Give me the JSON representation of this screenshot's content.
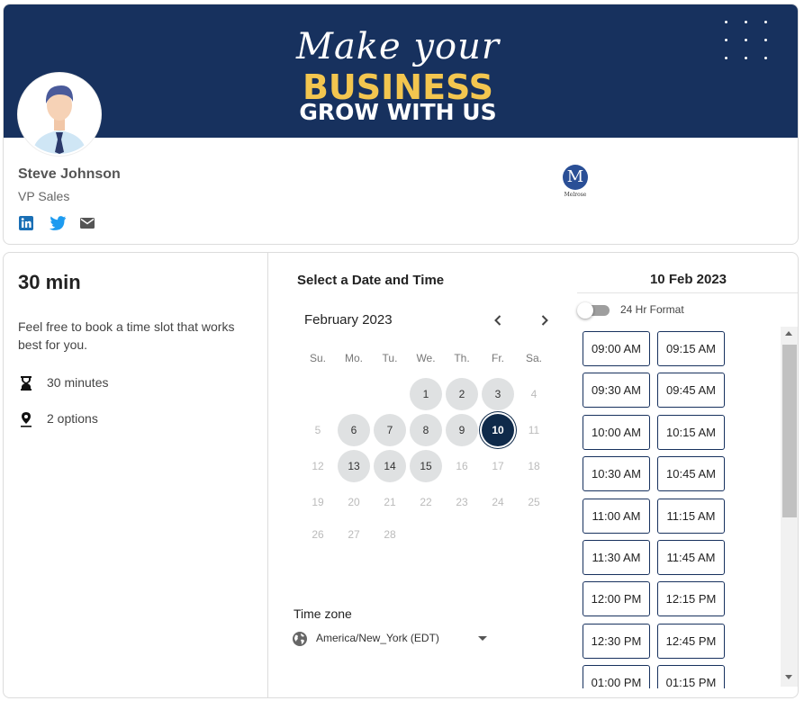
{
  "banner": {
    "line1": "Make your",
    "line2": "BUSINESS",
    "line3": "GROW WITH US",
    "bg_color": "#17315e",
    "accent_color": "#f3c64f"
  },
  "profile": {
    "name": "Steve Johnson",
    "title": "VP Sales",
    "socials": [
      "linkedin-icon",
      "twitter-icon",
      "email-icon"
    ],
    "company_logo": {
      "letter": "M",
      "text": "Melrose"
    }
  },
  "event": {
    "duration_title": "30 min",
    "description": "Feel free to book a time slot that works best for you.",
    "duration_text": "30 minutes",
    "location_text": "2 options"
  },
  "calendar": {
    "heading": "Select a Date and Time",
    "month": "February 2023",
    "weekdays": [
      "Su.",
      "Mo.",
      "Tu.",
      "We.",
      "Th.",
      "Fr.",
      "Sa."
    ],
    "days": [
      {
        "d": "1",
        "s": "avail"
      },
      {
        "d": "2",
        "s": "avail"
      },
      {
        "d": "3",
        "s": "avail"
      },
      {
        "d": "4",
        "s": "off"
      },
      {
        "d": "5",
        "s": "off"
      },
      {
        "d": "6",
        "s": "avail"
      },
      {
        "d": "7",
        "s": "avail"
      },
      {
        "d": "8",
        "s": "avail"
      },
      {
        "d": "9",
        "s": "avail"
      },
      {
        "d": "10",
        "s": "selected"
      },
      {
        "d": "11",
        "s": "off"
      },
      {
        "d": "12",
        "s": "off"
      },
      {
        "d": "13",
        "s": "avail"
      },
      {
        "d": "14",
        "s": "avail"
      },
      {
        "d": "15",
        "s": "avail"
      },
      {
        "d": "16",
        "s": "off"
      },
      {
        "d": "17",
        "s": "off"
      },
      {
        "d": "18",
        "s": "off"
      },
      {
        "d": "19",
        "s": "off"
      },
      {
        "d": "20",
        "s": "off"
      },
      {
        "d": "21",
        "s": "off"
      },
      {
        "d": "22",
        "s": "off"
      },
      {
        "d": "23",
        "s": "off"
      },
      {
        "d": "24",
        "s": "off"
      },
      {
        "d": "25",
        "s": "off"
      },
      {
        "d": "26",
        "s": "off"
      },
      {
        "d": "27",
        "s": "off"
      },
      {
        "d": "28",
        "s": "off"
      }
    ],
    "first_weekday": 3,
    "selected_color": "#0f2a4a"
  },
  "timezone": {
    "label": "Time zone",
    "value": "America/New_York (EDT)"
  },
  "slots": {
    "date": "10 Feb 2023",
    "format_label": "24 Hr Format",
    "format_24h": false,
    "times": [
      "09:00 AM",
      "09:15 AM",
      "09:30 AM",
      "09:45 AM",
      "10:00 AM",
      "10:15 AM",
      "10:30 AM",
      "10:45 AM",
      "11:00 AM",
      "11:15 AM",
      "11:30 AM",
      "11:45 AM",
      "12:00 PM",
      "12:15 PM",
      "12:30 PM",
      "12:45 PM",
      "01:00 PM",
      "01:15 PM"
    ]
  }
}
